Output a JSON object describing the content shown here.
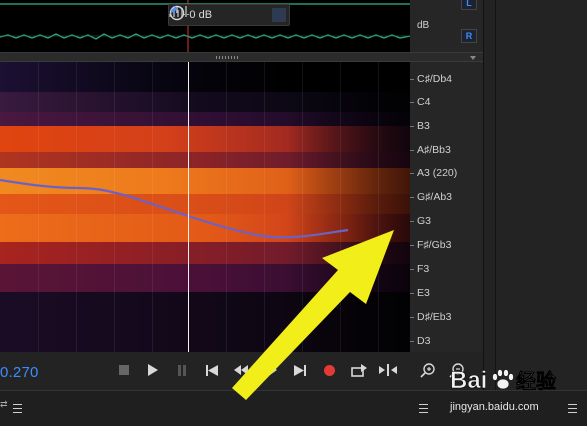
{
  "toolbar": {
    "gain_value": "+0 dB"
  },
  "meter": {
    "channel_left": "L",
    "channel_right": "R",
    "unit_label": "dB"
  },
  "note_ruler": {
    "labels": [
      "C♯/Db4",
      "C4",
      "B3",
      "A♯/Bb3",
      "A3 (220)",
      "G♯/Ab3",
      "G3",
      "F♯/Gb3",
      "F3",
      "E3",
      "D♯/Eb3",
      "D3"
    ]
  },
  "transport": {
    "time": "0.270",
    "buttons": [
      "stop-icon",
      "play-icon",
      "pause-icon",
      "skip-back-icon",
      "rewind-icon",
      "fast-forward-icon",
      "skip-forward-icon",
      "record-icon",
      "loop-icon",
      "skip-selection-icon"
    ]
  },
  "zoom_tools": [
    "zoom-in-vertical-icon",
    "zoom-out-vertical-icon"
  ],
  "bottom_bar": {
    "left_glyph": "⇄",
    "right_text": "jingyan.baidu.com"
  },
  "watermark": {
    "brand": "Bai",
    "brand_suffix": "经验"
  },
  "colors": {
    "accent": "#3d8cff",
    "waveform": "#41c9a0",
    "playhead": "#f2f2f2",
    "annotation_arrow": "#f2ee1a"
  }
}
